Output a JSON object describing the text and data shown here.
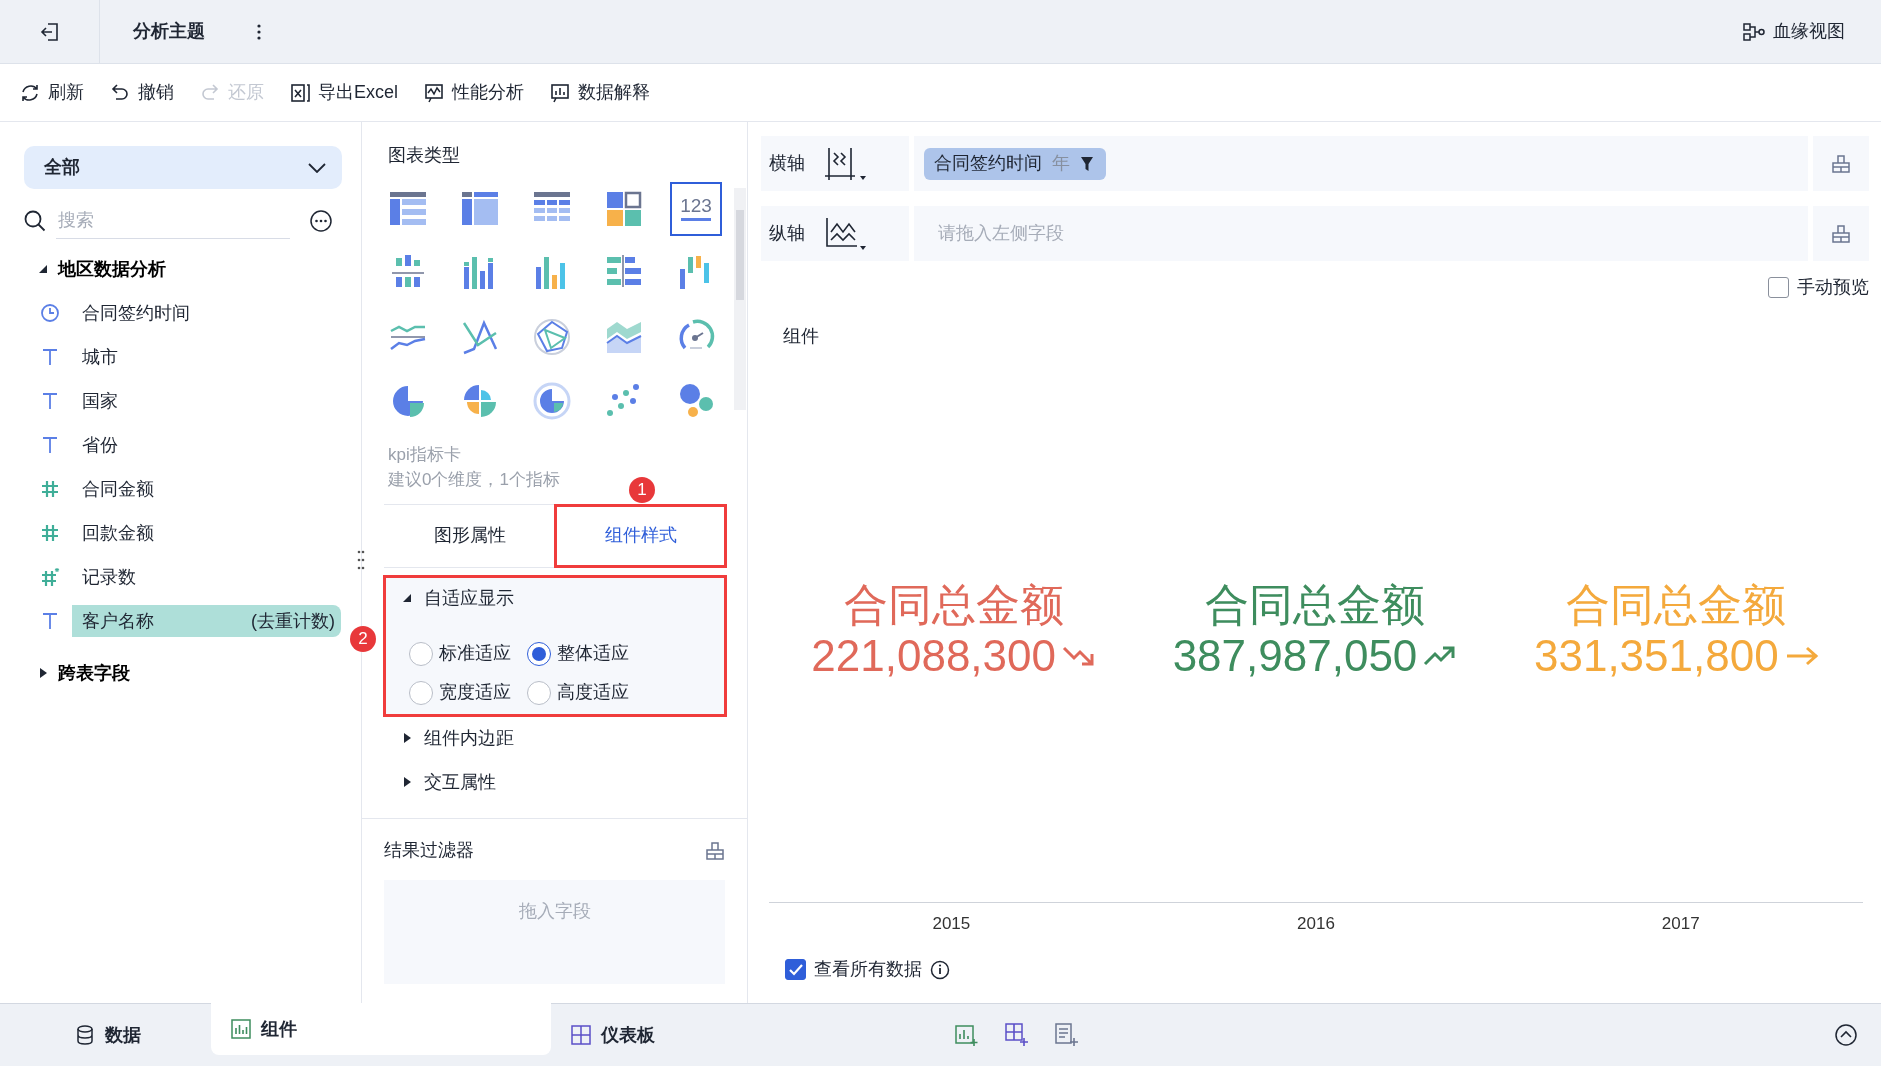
{
  "topbar": {
    "title": "分析主题",
    "lineage": "血缘视图"
  },
  "toolbar": [
    {
      "label": "刷新",
      "kind": "refresh",
      "disabled": false
    },
    {
      "label": "撤销",
      "kind": "undo",
      "disabled": false
    },
    {
      "label": "还原",
      "kind": "redo",
      "disabled": true
    },
    {
      "label": "导出Excel",
      "kind": "export",
      "disabled": false
    },
    {
      "label": "性能分析",
      "kind": "performance",
      "disabled": false
    },
    {
      "label": "数据解释",
      "kind": "explain",
      "disabled": false
    }
  ],
  "fields": {
    "dropdown": "全部",
    "search": {
      "placeholder": "搜索"
    },
    "groups": [
      {
        "label": "地区数据分析",
        "expanded": true,
        "children": [
          {
            "label": "合同签约时间",
            "kind": "date",
            "selected": false
          },
          {
            "label": "城市",
            "kind": "text",
            "selected": false
          },
          {
            "label": "国家",
            "kind": "text",
            "selected": false
          },
          {
            "label": "省份",
            "kind": "text",
            "selected": false
          },
          {
            "label": "合同金额",
            "kind": "number",
            "selected": false
          },
          {
            "label": "回款金额",
            "kind": "number",
            "selected": false
          },
          {
            "label": "记录数",
            "kind": "count",
            "selected": false
          },
          {
            "label": "客户名称",
            "kind": "text",
            "selected": true,
            "suffix": "(去重计数)"
          }
        ]
      },
      {
        "label": "跨表字段",
        "expanded": false
      }
    ]
  },
  "chart_types": {
    "title": "图表类型",
    "items": [
      {
        "kind": "detail-table",
        "selected": false
      },
      {
        "kind": "group-table",
        "selected": false
      },
      {
        "kind": "cross-table",
        "selected": false
      },
      {
        "kind": "multi-block",
        "selected": false
      },
      {
        "kind": "kpi",
        "selected": true,
        "icon_text": "123"
      },
      {
        "kind": "grouped-bar",
        "selected": false
      },
      {
        "kind": "multi-bar",
        "selected": false
      },
      {
        "kind": "bar",
        "selected": false
      },
      {
        "kind": "horizontal-bar",
        "selected": false
      },
      {
        "kind": "waterfall",
        "selected": false
      },
      {
        "kind": "line",
        "selected": false
      },
      {
        "kind": "cross-line",
        "selected": false
      },
      {
        "kind": "radar",
        "selected": false
      },
      {
        "kind": "area",
        "selected": false
      },
      {
        "kind": "gauge",
        "selected": false
      },
      {
        "kind": "pie",
        "selected": false
      },
      {
        "kind": "rose",
        "selected": false
      },
      {
        "kind": "donut",
        "selected": false
      },
      {
        "kind": "scatter",
        "selected": false
      },
      {
        "kind": "bubble",
        "selected": false
      }
    ],
    "hint_title": "kpi指标卡",
    "hint": "建议0个维度，1个指标"
  },
  "property_tabs": [
    {
      "label": "图形属性",
      "selected": false
    },
    {
      "label": "组件样式",
      "selected": true,
      "annotation": "1"
    }
  ],
  "style_sections": [
    {
      "label": "自适应显示",
      "expanded": true,
      "annotation": "2",
      "options": [
        {
          "label": "标准适应",
          "selected": false
        },
        {
          "label": "整体适应",
          "selected": true
        },
        {
          "label": "宽度适应",
          "selected": false
        },
        {
          "label": "高度适应",
          "selected": false
        }
      ]
    },
    {
      "label": "组件内边距",
      "expanded": false
    },
    {
      "label": "交互属性",
      "expanded": false
    }
  ],
  "result_filter": {
    "title": "结果过滤器",
    "placeholder": "拖入字段"
  },
  "axes": [
    {
      "label": "横轴",
      "kind": "x",
      "pills": [
        {
          "label": "合同签约时间",
          "unit": "年"
        }
      ]
    },
    {
      "label": "纵轴",
      "kind": "y",
      "placeholder": "请拖入左侧字段"
    }
  ],
  "manual_preview": {
    "label": "手动预览",
    "checked": false
  },
  "component": {
    "title": "组件",
    "kpis": [
      {
        "title": "合同总金额",
        "value": "221,088,300",
        "kind": "down",
        "color": "#e0695a"
      },
      {
        "title": "合同总金额",
        "value": "387,987,050",
        "kind": "up",
        "color": "#3e8d5e"
      },
      {
        "title": "合同总金额",
        "value": "331,351,800",
        "kind": "flat",
        "color": "#f4a93c"
      }
    ],
    "categories": [
      "2015",
      "2016",
      "2017"
    ]
  },
  "view_all": {
    "label": "查看所有数据",
    "checked": true
  },
  "bottom_tabs": [
    {
      "label": "数据",
      "kind": "data",
      "selected": false
    },
    {
      "label": "组件",
      "kind": "component",
      "selected": true
    },
    {
      "label": "仪表板",
      "kind": "dashboard",
      "selected": false
    }
  ]
}
